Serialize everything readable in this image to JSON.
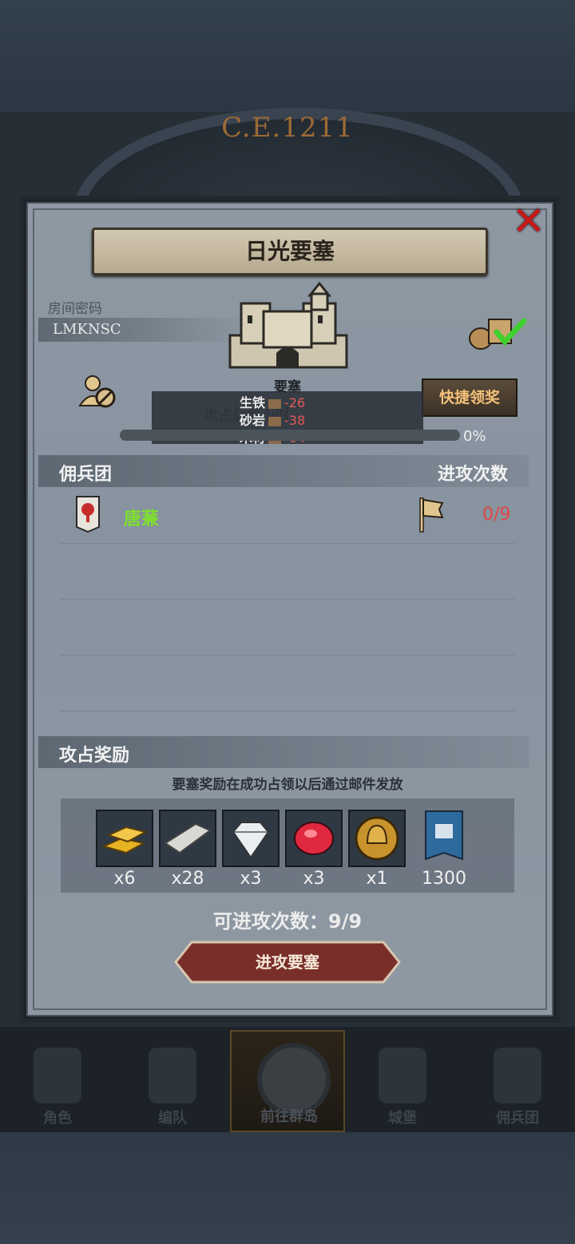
{
  "era": "C.E.1211",
  "dialog": {
    "title": "日光要塞",
    "close_icon": "close-icon"
  },
  "room": {
    "label": "房间密码",
    "code": "LMKNSC"
  },
  "fortress": {
    "label": "要塞",
    "quick_claim": "快捷领奖",
    "overlay_text": "攻占后每小时",
    "resources": [
      {
        "name": "生铁",
        "value": "-26"
      },
      {
        "name": "砂岩",
        "value": "-38"
      },
      {
        "name": "木材",
        "value": "-64"
      }
    ],
    "progress_text": "0%",
    "progress_value": 0
  },
  "mercenary": {
    "section_title": "佣兵团",
    "right_title": "进攻次数",
    "rows": [
      {
        "name": "唐蒹",
        "count": "0/9"
      }
    ]
  },
  "rewards": {
    "section_title": "攻占奖励",
    "note": "要塞奖励在成功占领以后通过邮件发放",
    "items": [
      {
        "icon": "gold-bar-icon",
        "qty": "x6"
      },
      {
        "icon": "silver-bar-icon",
        "qty": "x28"
      },
      {
        "icon": "diamond-icon",
        "qty": "x3"
      },
      {
        "icon": "ruby-icon",
        "qty": "x3"
      },
      {
        "icon": "helmet-coin-icon",
        "qty": "x1"
      },
      {
        "icon": "guild-banner-icon",
        "qty": "1300"
      }
    ],
    "attempts": "可进攻次数：9/9",
    "attack_button": "进攻要塞"
  },
  "nav": {
    "items": [
      {
        "label": "角色"
      },
      {
        "label": "编队"
      },
      {
        "label": "前往群岛"
      },
      {
        "label": "城堡"
      },
      {
        "label": "佣兵团"
      }
    ]
  },
  "colors": {
    "accent_red": "#e04545",
    "guild_green": "#7fe02d",
    "button_gold": "#f4c07a"
  }
}
